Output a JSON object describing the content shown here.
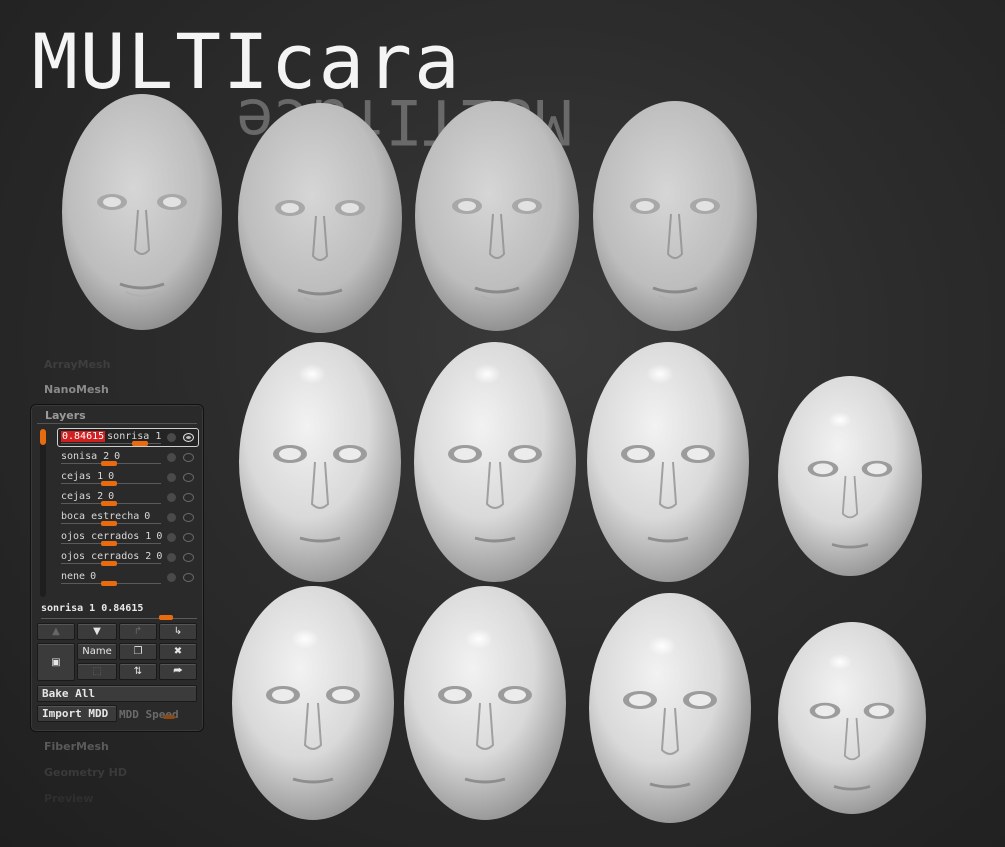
{
  "title": "MULTIcara",
  "subtitle_reflected": "MULTIface",
  "menu_above": [
    "ArrayMesh",
    "NanoMesh"
  ],
  "menu_below": [
    "FiberMesh",
    "Geometry HD",
    "Preview"
  ],
  "layers_panel": {
    "title": "Layers",
    "layers": [
      {
        "name": "sonrisa 1",
        "value": "0.84615",
        "selected": true,
        "knob_fraction": 0.85
      },
      {
        "name": "sonisa 2",
        "value": "0",
        "selected": false,
        "knob_fraction": 0.0
      },
      {
        "name": "cejas 1",
        "value": "0",
        "selected": false,
        "knob_fraction": 0.0
      },
      {
        "name": "cejas 2",
        "value": "0",
        "selected": false,
        "knob_fraction": 0.0
      },
      {
        "name": "boca estrecha",
        "value": "0",
        "selected": false,
        "knob_fraction": 0.0
      },
      {
        "name": "ojos cerrados 1",
        "value": "0",
        "selected": false,
        "knob_fraction": 0.0
      },
      {
        "name": "ojos cerrados 2",
        "value": "0",
        "selected": false,
        "knob_fraction": 0.0
      },
      {
        "name": "nene",
        "value": "0",
        "selected": false,
        "knob_fraction": 0.0
      }
    ],
    "current_layer_label": "sonrisa 1",
    "current_layer_value": "0.84615",
    "name_button": "Name",
    "bake_all_button": "Bake All",
    "import_mdd_button": "Import MDD",
    "mdd_speed_label": "MDD Speed"
  },
  "colors": {
    "accent": "#e86b10",
    "selected_value_bg": "#d02020",
    "background": "#2c2c2c",
    "face": "#e6e6e6"
  }
}
